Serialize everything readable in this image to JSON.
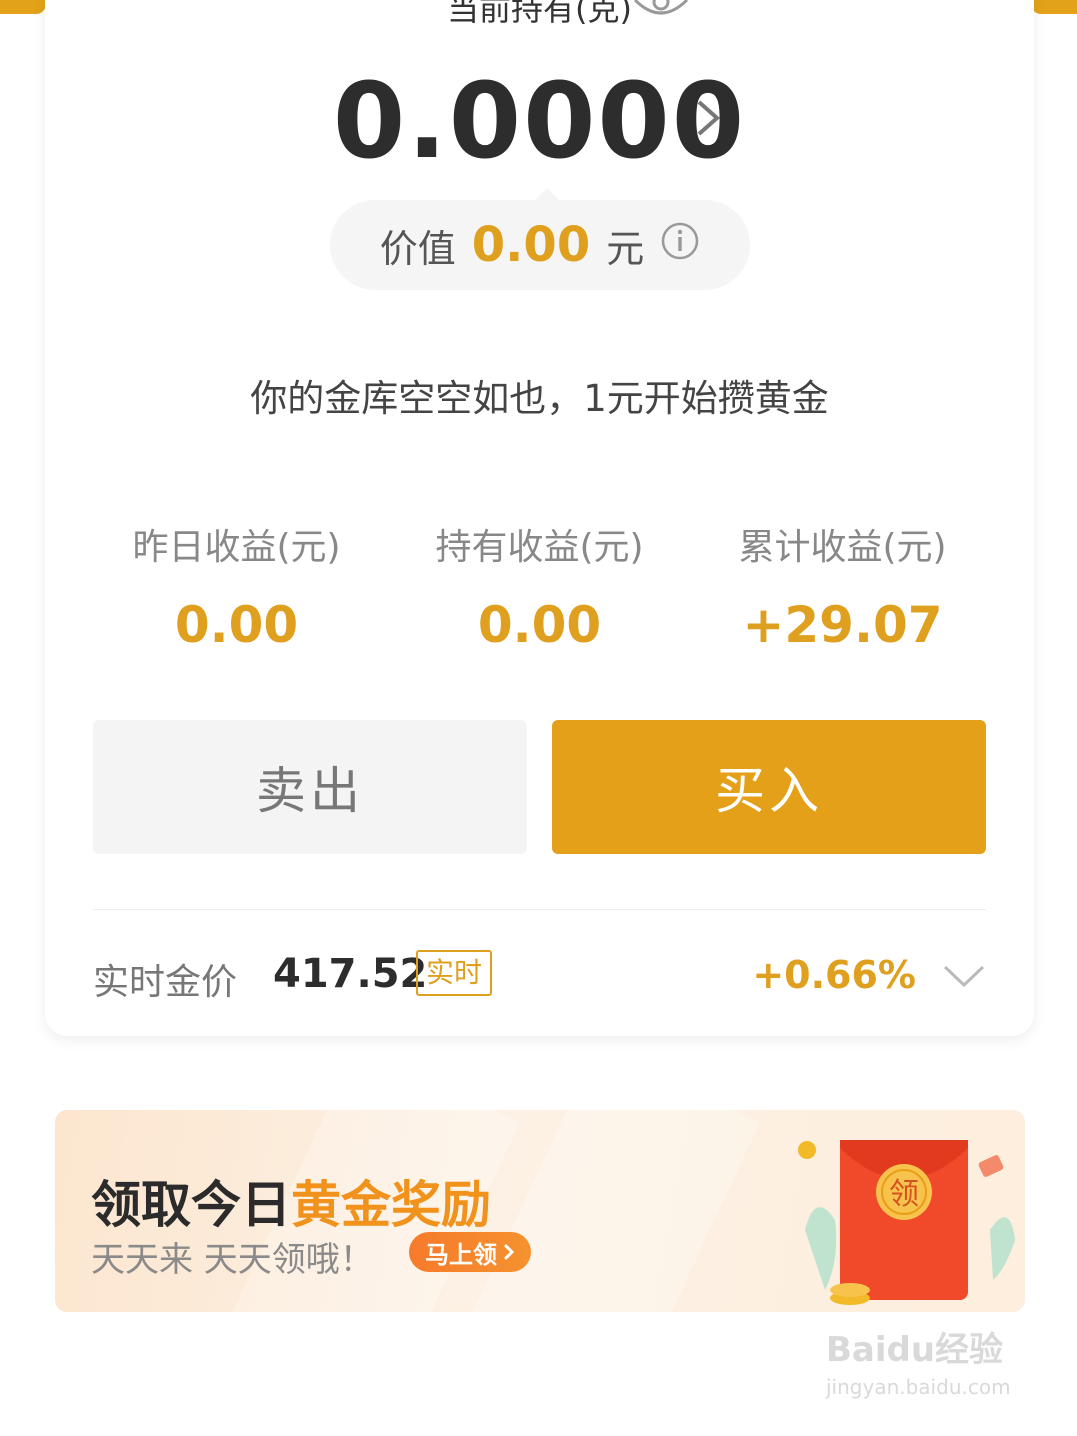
{
  "holding": {
    "label": "当前持有(克)",
    "amount": "0.0000",
    "value_prefix": "价值",
    "value_amount": "0.00",
    "value_unit": "元"
  },
  "empty_hint": "你的金库空空如也，1元开始攒黄金",
  "stats": [
    {
      "label": "昨日收益(元)",
      "value": "0.00"
    },
    {
      "label": "持有收益(元)",
      "value": "0.00"
    },
    {
      "label": "累计收益(元)",
      "value": "+29.07"
    }
  ],
  "actions": {
    "sell": "卖出",
    "buy": "买入"
  },
  "gold_price": {
    "label": "实时金价",
    "value": "417.52",
    "badge": "实时",
    "change": "+0.66%"
  },
  "banner": {
    "title_plain": "领取今日",
    "title_highlight": "黄金奖励",
    "subtitle": "天天来 天天领哦！",
    "cta": "马上领",
    "envelope_char": "领"
  },
  "watermark": {
    "brand": "Baidu经验",
    "url": "jingyan.baidu.com"
  },
  "colors": {
    "accent": "#e0a01f",
    "buy_button": "#e5a019",
    "envelope_red": "#f04a2b"
  },
  "icons": [
    "eye-icon",
    "chevron-right-icon",
    "info-icon",
    "chevron-down-icon",
    "red-envelope-icon"
  ]
}
